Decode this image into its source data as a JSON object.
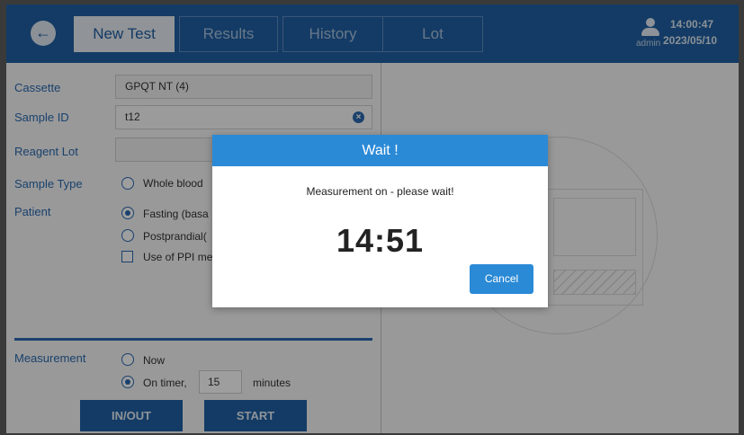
{
  "header": {
    "tabs": [
      {
        "label": "New Test",
        "active": true
      },
      {
        "label": "Results",
        "active": false
      },
      {
        "label": "History",
        "active": false
      },
      {
        "label": "Lot",
        "active": false
      }
    ],
    "user": "admin",
    "time": "14:00:47",
    "date": "2023/05/10",
    "back_icon": "back-arrow-icon",
    "user_icon": "user-icon"
  },
  "form": {
    "cassette_label": "Cassette",
    "cassette_value": "GPQT NT (4)",
    "sample_id_label": "Sample ID",
    "sample_id_value": "t12",
    "reagent_lot_label": "Reagent Lot",
    "reagent_lot_value": "",
    "sample_type_label": "Sample Type",
    "sample_type_option": "Whole blood",
    "patient_label": "Patient",
    "patient_option_1": "Fasting (basa",
    "patient_option_2": "Postprandial(",
    "ppi_option": "Use of PPI me",
    "measurement_label": "Measurement",
    "measurement_now": "Now",
    "measurement_timer": "On timer,",
    "timer_value": "15",
    "timer_unit": "minutes",
    "inout_label": "IN/OUT",
    "start_label": "START"
  },
  "modal": {
    "title": "Wait !",
    "message": "Measurement on - please wait!",
    "countdown": "14:51",
    "cancel_label": "Cancel"
  },
  "colors": {
    "header_blue": "#1f5fa3",
    "modal_blue": "#2b8ad6",
    "label_blue": "#2a6ab0"
  }
}
